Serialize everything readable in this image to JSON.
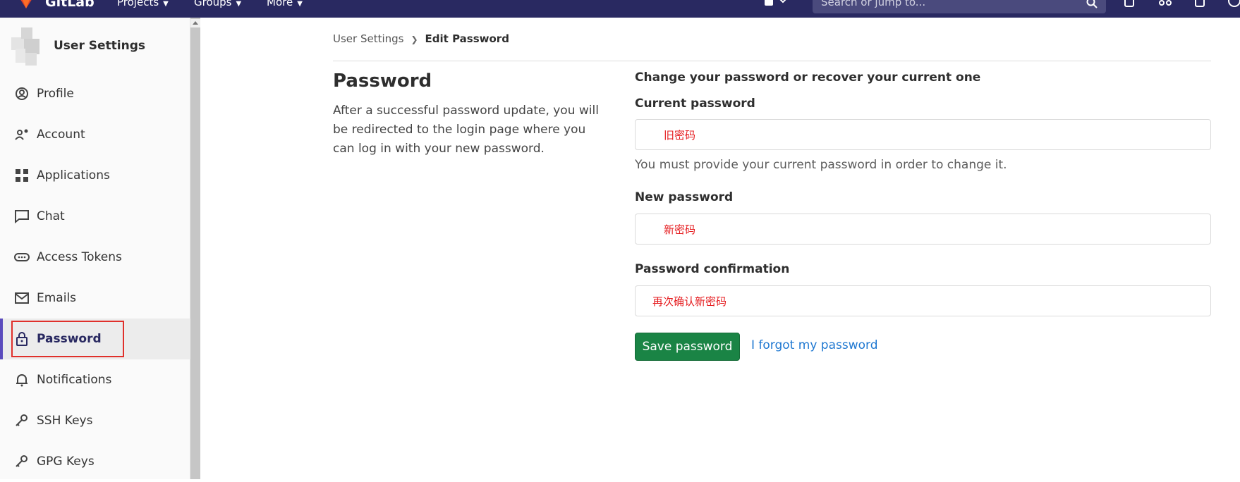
{
  "topbar": {
    "brand": "GitLab",
    "menus": [
      "Projects",
      "Groups",
      "More"
    ],
    "search_placeholder": "Search or jump to...",
    "bg_color": "#292961"
  },
  "sidebar": {
    "title": "User Settings",
    "items": [
      {
        "label": "Profile",
        "icon": "profile-icon"
      },
      {
        "label": "Account",
        "icon": "account-icon"
      },
      {
        "label": "Applications",
        "icon": "applications-icon"
      },
      {
        "label": "Chat",
        "icon": "chat-icon"
      },
      {
        "label": "Access Tokens",
        "icon": "access-tokens-icon"
      },
      {
        "label": "Emails",
        "icon": "email-icon"
      },
      {
        "label": "Password",
        "icon": "lock-icon",
        "active": true
      },
      {
        "label": "Notifications",
        "icon": "bell-icon"
      },
      {
        "label": "SSH Keys",
        "icon": "key-icon"
      },
      {
        "label": "GPG Keys",
        "icon": "key-icon"
      }
    ]
  },
  "breadcrumb": {
    "parent": "User Settings",
    "current": "Edit Password"
  },
  "left": {
    "title": "Password",
    "description": "After a successful password update, you will be redirected to the login page where you can log in with your new password."
  },
  "form": {
    "intro": "Change your password or recover your current one",
    "current_label": "Current password",
    "current_value": "旧密码",
    "current_help": "You must provide your current password in order to change it.",
    "new_label": "New password",
    "new_value": "新密码",
    "confirm_label": "Password confirmation",
    "confirm_value": "再次确认新密码",
    "save_label": "Save password",
    "forgot_label": "I forgot my password"
  },
  "colors": {
    "accent": "#5b4bbd",
    "save_button": "#1a8445",
    "link": "#1f78d1",
    "annotation_red": "#e5191c"
  }
}
